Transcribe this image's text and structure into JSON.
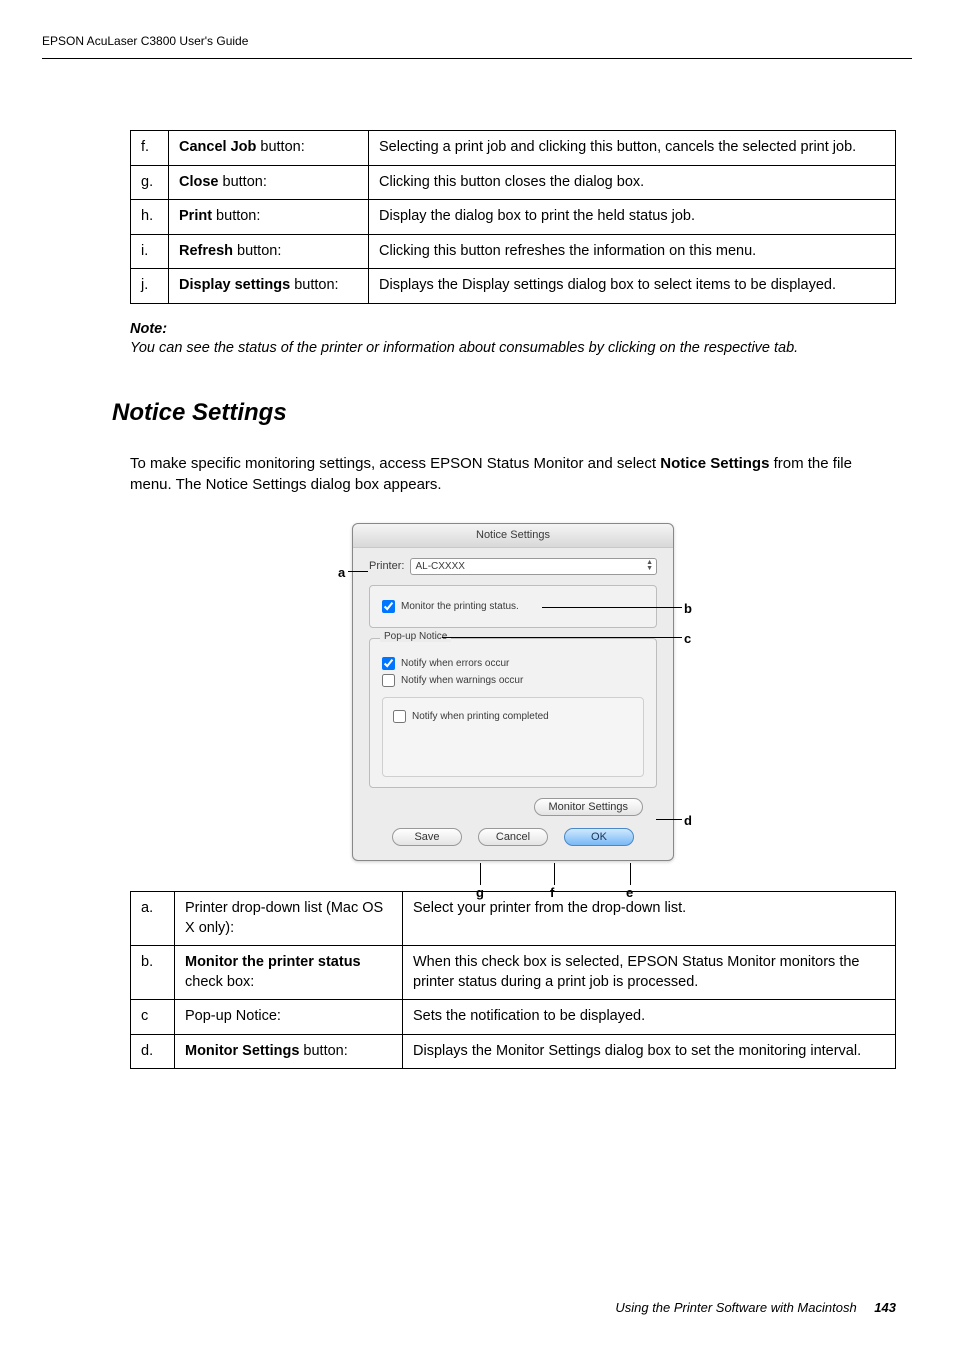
{
  "header": "EPSON AcuLaser C3800     User's Guide",
  "table1": {
    "rows": [
      {
        "idx": "f.",
        "label_bold": "Cancel Job",
        "label_rest": " button:",
        "desc": "Selecting a print job and clicking this button, cancels the selected print job."
      },
      {
        "idx": "g.",
        "label_bold": "Close",
        "label_rest": " button:",
        "desc": "Clicking this button closes the dialog box."
      },
      {
        "idx": "h.",
        "label_bold": "Print",
        "label_rest": " button:",
        "desc": "Display the dialog box to print the held status job."
      },
      {
        "idx": "i.",
        "label_bold": "Refresh",
        "label_rest": " button:",
        "desc": "Clicking this button refreshes the information on this menu."
      },
      {
        "idx": "j.",
        "label_bold": "Display settings",
        "label_rest": " button:",
        "desc": "Displays the Display settings dialog box to select items to be displayed."
      }
    ]
  },
  "note": {
    "title": "Note:",
    "body": "You can see the status of the printer or information about consumables by clicking on the respective tab."
  },
  "h2": "Notice Settings",
  "para_pre": "To make specific monitoring settings, access EPSON Status Monitor and select ",
  "para_bold": "Notice Settings",
  "para_post": " from the file menu. The Notice Settings dialog box appears.",
  "dialog": {
    "title": "Notice Settings",
    "printer_label": "Printer:",
    "printer_value": "AL-CXXXX",
    "monitor_label": "Monitor the printing status.",
    "popup_legend": "Pop-up Notice",
    "err_label": "Notify when errors occur",
    "warn_label": "Notify when warnings occur",
    "comp_label": "Notify when printing completed",
    "monitor_settings_btn": "Monitor Settings",
    "save_btn": "Save",
    "cancel_btn": "Cancel",
    "ok_btn": "OK"
  },
  "callouts": {
    "a": "a",
    "b": "b",
    "c": "c",
    "d": "d",
    "e": "e",
    "f": "f",
    "g": "g"
  },
  "table2": {
    "rows": [
      {
        "idx": "a.",
        "label_bold": "",
        "label_rest": "Printer drop-down list (Mac OS X only):",
        "desc": "Select your printer from the drop-down list."
      },
      {
        "idx": "b.",
        "label_bold": "Monitor the printer status",
        "label_rest": " check box:",
        "desc": "When this check box is selected, EPSON Status Monitor monitors the printer status during a print job is processed."
      },
      {
        "idx": "c",
        "label_bold": "",
        "label_rest": "Pop-up Notice:",
        "desc": "Sets the notification to be displayed."
      },
      {
        "idx": "d.",
        "label_bold": "Monitor Settings",
        "label_rest": " button:",
        "desc": "Displays the Monitor Settings dialog box to set the monitoring interval."
      }
    ]
  },
  "footer": {
    "text": "Using the Printer Software with Macintosh",
    "page": "143"
  }
}
